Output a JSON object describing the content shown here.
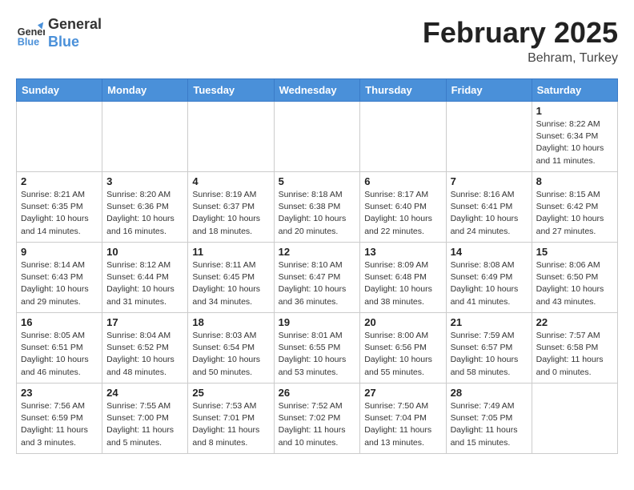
{
  "header": {
    "logo_general": "General",
    "logo_blue": "Blue",
    "month_year": "February 2025",
    "location": "Behram, Turkey"
  },
  "days_of_week": [
    "Sunday",
    "Monday",
    "Tuesday",
    "Wednesday",
    "Thursday",
    "Friday",
    "Saturday"
  ],
  "weeks": [
    [
      {
        "day": "",
        "info": ""
      },
      {
        "day": "",
        "info": ""
      },
      {
        "day": "",
        "info": ""
      },
      {
        "day": "",
        "info": ""
      },
      {
        "day": "",
        "info": ""
      },
      {
        "day": "",
        "info": ""
      },
      {
        "day": "1",
        "info": "Sunrise: 8:22 AM\nSunset: 6:34 PM\nDaylight: 10 hours\nand 11 minutes."
      }
    ],
    [
      {
        "day": "2",
        "info": "Sunrise: 8:21 AM\nSunset: 6:35 PM\nDaylight: 10 hours\nand 14 minutes."
      },
      {
        "day": "3",
        "info": "Sunrise: 8:20 AM\nSunset: 6:36 PM\nDaylight: 10 hours\nand 16 minutes."
      },
      {
        "day": "4",
        "info": "Sunrise: 8:19 AM\nSunset: 6:37 PM\nDaylight: 10 hours\nand 18 minutes."
      },
      {
        "day": "5",
        "info": "Sunrise: 8:18 AM\nSunset: 6:38 PM\nDaylight: 10 hours\nand 20 minutes."
      },
      {
        "day": "6",
        "info": "Sunrise: 8:17 AM\nSunset: 6:40 PM\nDaylight: 10 hours\nand 22 minutes."
      },
      {
        "day": "7",
        "info": "Sunrise: 8:16 AM\nSunset: 6:41 PM\nDaylight: 10 hours\nand 24 minutes."
      },
      {
        "day": "8",
        "info": "Sunrise: 8:15 AM\nSunset: 6:42 PM\nDaylight: 10 hours\nand 27 minutes."
      }
    ],
    [
      {
        "day": "9",
        "info": "Sunrise: 8:14 AM\nSunset: 6:43 PM\nDaylight: 10 hours\nand 29 minutes."
      },
      {
        "day": "10",
        "info": "Sunrise: 8:12 AM\nSunset: 6:44 PM\nDaylight: 10 hours\nand 31 minutes."
      },
      {
        "day": "11",
        "info": "Sunrise: 8:11 AM\nSunset: 6:45 PM\nDaylight: 10 hours\nand 34 minutes."
      },
      {
        "day": "12",
        "info": "Sunrise: 8:10 AM\nSunset: 6:47 PM\nDaylight: 10 hours\nand 36 minutes."
      },
      {
        "day": "13",
        "info": "Sunrise: 8:09 AM\nSunset: 6:48 PM\nDaylight: 10 hours\nand 38 minutes."
      },
      {
        "day": "14",
        "info": "Sunrise: 8:08 AM\nSunset: 6:49 PM\nDaylight: 10 hours\nand 41 minutes."
      },
      {
        "day": "15",
        "info": "Sunrise: 8:06 AM\nSunset: 6:50 PM\nDaylight: 10 hours\nand 43 minutes."
      }
    ],
    [
      {
        "day": "16",
        "info": "Sunrise: 8:05 AM\nSunset: 6:51 PM\nDaylight: 10 hours\nand 46 minutes."
      },
      {
        "day": "17",
        "info": "Sunrise: 8:04 AM\nSunset: 6:52 PM\nDaylight: 10 hours\nand 48 minutes."
      },
      {
        "day": "18",
        "info": "Sunrise: 8:03 AM\nSunset: 6:54 PM\nDaylight: 10 hours\nand 50 minutes."
      },
      {
        "day": "19",
        "info": "Sunrise: 8:01 AM\nSunset: 6:55 PM\nDaylight: 10 hours\nand 53 minutes."
      },
      {
        "day": "20",
        "info": "Sunrise: 8:00 AM\nSunset: 6:56 PM\nDaylight: 10 hours\nand 55 minutes."
      },
      {
        "day": "21",
        "info": "Sunrise: 7:59 AM\nSunset: 6:57 PM\nDaylight: 10 hours\nand 58 minutes."
      },
      {
        "day": "22",
        "info": "Sunrise: 7:57 AM\nSunset: 6:58 PM\nDaylight: 11 hours\nand 0 minutes."
      }
    ],
    [
      {
        "day": "23",
        "info": "Sunrise: 7:56 AM\nSunset: 6:59 PM\nDaylight: 11 hours\nand 3 minutes."
      },
      {
        "day": "24",
        "info": "Sunrise: 7:55 AM\nSunset: 7:00 PM\nDaylight: 11 hours\nand 5 minutes."
      },
      {
        "day": "25",
        "info": "Sunrise: 7:53 AM\nSunset: 7:01 PM\nDaylight: 11 hours\nand 8 minutes."
      },
      {
        "day": "26",
        "info": "Sunrise: 7:52 AM\nSunset: 7:02 PM\nDaylight: 11 hours\nand 10 minutes."
      },
      {
        "day": "27",
        "info": "Sunrise: 7:50 AM\nSunset: 7:04 PM\nDaylight: 11 hours\nand 13 minutes."
      },
      {
        "day": "28",
        "info": "Sunrise: 7:49 AM\nSunset: 7:05 PM\nDaylight: 11 hours\nand 15 minutes."
      },
      {
        "day": "",
        "info": ""
      }
    ]
  ]
}
